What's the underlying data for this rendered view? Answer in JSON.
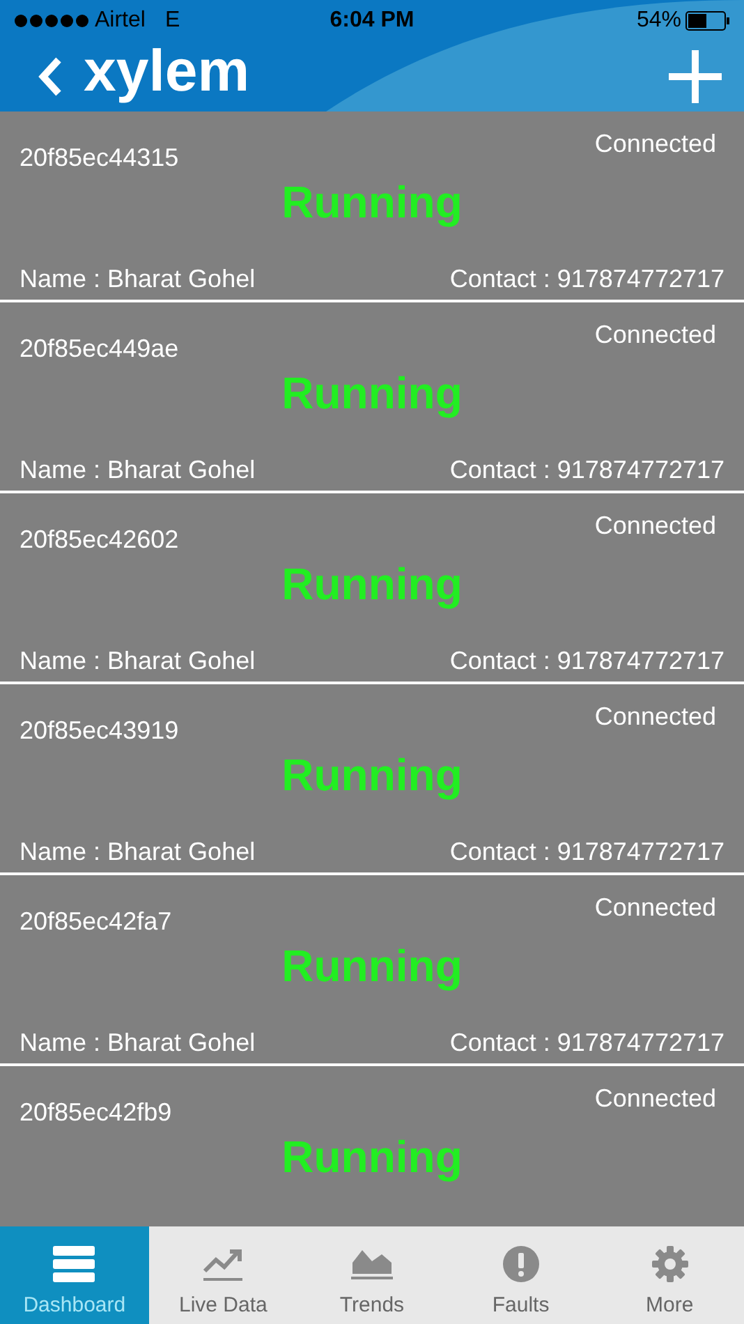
{
  "status_bar": {
    "carrier": "Airtel",
    "network": "E",
    "time": "6:04 PM",
    "battery": "54%"
  },
  "header": {
    "logo": "xylem"
  },
  "devices": [
    {
      "id": "20f85ec44315",
      "connection": "Connected",
      "status": "Running",
      "name": "Name : Bharat Gohel",
      "contact": "Contact : 917874772717"
    },
    {
      "id": "20f85ec449ae",
      "connection": "Connected",
      "status": "Running",
      "name": "Name : Bharat Gohel",
      "contact": "Contact : 917874772717"
    },
    {
      "id": "20f85ec42602",
      "connection": "Connected",
      "status": "Running",
      "name": "Name : Bharat Gohel",
      "contact": "Contact : 917874772717"
    },
    {
      "id": "20f85ec43919",
      "connection": "Connected",
      "status": "Running",
      "name": "Name : Bharat Gohel",
      "contact": "Contact : 917874772717"
    },
    {
      "id": "20f85ec42fa7",
      "connection": "Connected",
      "status": "Running",
      "name": "Name : Bharat Gohel",
      "contact": "Contact : 917874772717"
    },
    {
      "id": "20f85ec42fb9",
      "connection": "Connected",
      "status": "Running"
    }
  ],
  "tabs": [
    {
      "label": "Dashboard",
      "selected": true
    },
    {
      "label": "Live Data",
      "selected": false
    },
    {
      "label": "Trends",
      "selected": false
    },
    {
      "label": "Faults",
      "selected": false
    },
    {
      "label": "More",
      "selected": false
    }
  ]
}
